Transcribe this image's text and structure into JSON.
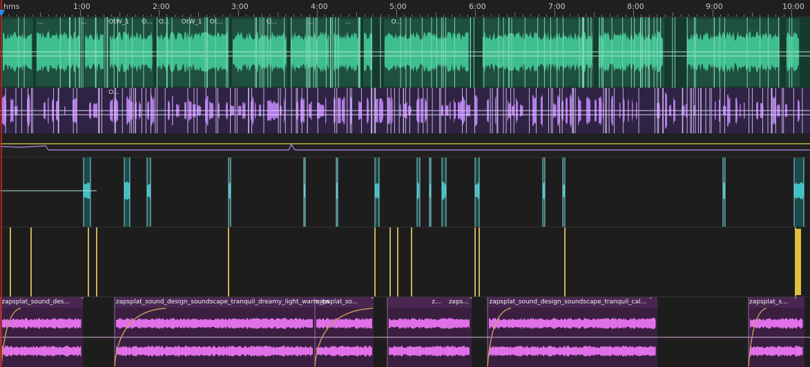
{
  "ruler": {
    "unit_label": "hms",
    "times": [
      "1:00",
      "2:00",
      "3:00",
      "4:00",
      "5:00",
      "6:00",
      "7:00",
      "8:00",
      "9:00",
      "10:00"
    ]
  },
  "tracks": {
    "track1": {
      "color": "#3fbe8f",
      "clip_labels": [
        {
          "text": "...",
          "at": 0.046
        },
        {
          "text": "...",
          "at": 0.1
        },
        {
          "text": "OtW_1",
          "at": 0.134
        },
        {
          "text": "O...",
          "at": 0.175
        },
        {
          "text": "O...",
          "at": 0.196
        },
        {
          "text": "OtW_1",
          "at": 0.224
        },
        {
          "text": "Ot...",
          "at": 0.259
        },
        {
          "text": "O...",
          "at": 0.329
        },
        {
          "text": "...",
          "at": 0.379
        },
        {
          "text": "...",
          "at": 0.426
        },
        {
          "text": "O...",
          "at": 0.483
        }
      ]
    },
    "track2": {
      "color": "#b37be8",
      "clip_labels": [
        {
          "text": "O...",
          "at": 0.134
        }
      ]
    },
    "track4": {
      "color": "#3fc0c6"
    },
    "track5": {
      "color": "#c9b35a"
    },
    "track6": {
      "color": "#e070e8",
      "clips": [
        {
          "label": "zapsplat_sound_des...",
          "at": 0.002
        },
        {
          "label": "zapsplat_sound_design_soundscape_tranquil_dreamy_light_warm_tw",
          "at": 0.143
        },
        {
          "label": "zapsplat_so...",
          "at": 0.39
        },
        {
          "label": "z...",
          "at": 0.533
        },
        {
          "label": "zaps...",
          "at": 0.554
        },
        {
          "label": "zapsplat_sound_design_soundscape_tranquil_cal...",
          "at": 0.604
        },
        {
          "label": "zapsplat_s...",
          "at": 0.925
        }
      ]
    }
  }
}
